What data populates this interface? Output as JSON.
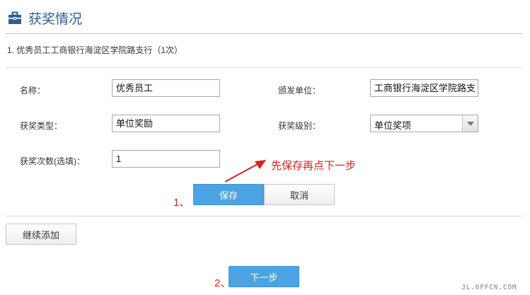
{
  "section": {
    "title": "获奖情况",
    "icon": "briefcase-icon"
  },
  "record": {
    "title": "1. 优秀员工工商银行海淀区学院路支行（1次）"
  },
  "form": {
    "name_label": "名称：",
    "name_value": "优秀员工",
    "issuer_label": "颁发单位：",
    "issuer_value": "工商银行海淀区学院路支",
    "award_type_label": "获奖类型：",
    "award_type_value": "单位奖励",
    "award_level_label": "获奖级别：",
    "award_level_value": "单位奖项",
    "count_label": "获奖次数(选填)：",
    "count_value": "1"
  },
  "actions": {
    "save_label": "保存",
    "cancel_label": "取消",
    "add_more_label": "继续添加",
    "next_label": "下一步"
  },
  "annotations": {
    "hint": "先保存再点下一步",
    "step1": "1、",
    "step2": "2、",
    "color": "#d9221c"
  },
  "watermark": "JL.OFFCN.COM",
  "colors": {
    "primary_button": "#4ba3e3",
    "title": "#2e5f93"
  }
}
